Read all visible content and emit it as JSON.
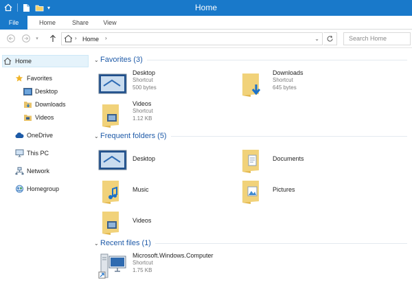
{
  "window": {
    "title": "Home"
  },
  "ribbon": {
    "tabs": [
      "File",
      "Home",
      "Share",
      "View"
    ]
  },
  "address": {
    "crumb": "Home",
    "search_placeholder": "Search Home"
  },
  "nav": {
    "home": "Home",
    "favorites": "Favorites",
    "fav_items": [
      "Desktop",
      "Downloads",
      "Videos"
    ],
    "onedrive": "OneDrive",
    "thispc": "This PC",
    "network": "Network",
    "homegroup": "Homegroup"
  },
  "content": {
    "favorites_title": "Favorites (3)",
    "favorites": [
      {
        "name": "Desktop",
        "type": "Shortcut",
        "size": "500 bytes"
      },
      {
        "name": "Downloads",
        "type": "Shortcut",
        "size": "645 bytes"
      },
      {
        "name": "Videos",
        "type": "Shortcut",
        "size": "1.12 KB"
      }
    ],
    "frequent_title": "Frequent folders (5)",
    "frequent": [
      "Desktop",
      "Documents",
      "Music",
      "Pictures",
      "Videos"
    ],
    "recent_title": "Recent files (1)",
    "recent": [
      {
        "name": "Microsoft.Windows.Computer",
        "type": "Shortcut",
        "size": "1.75 KB"
      }
    ]
  },
  "colors": {
    "titlebar": "#1979ca",
    "group_title": "#1e5aa8",
    "selection": "#e5f3fb"
  }
}
